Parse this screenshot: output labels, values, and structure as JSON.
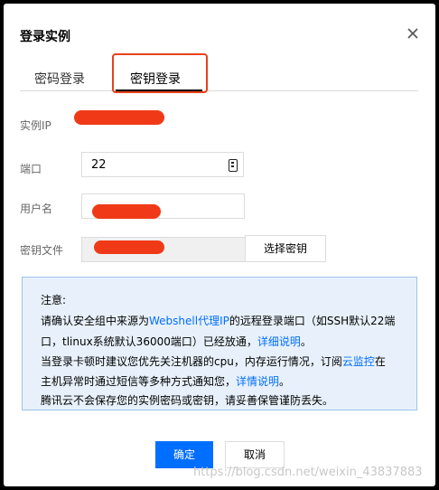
{
  "dialog": {
    "title": "登录实例",
    "close_icon": "close-icon"
  },
  "tabs": [
    {
      "label": "密码登录"
    },
    {
      "label": "密钥登录"
    }
  ],
  "form": {
    "instance_ip_label": "实例IP",
    "port_label": "端口",
    "port_value": "22",
    "username_label": "用户名",
    "key_file_label": "密钥文件",
    "select_key_button": "选择密钥"
  },
  "notice": {
    "title": "注意:",
    "line1_a": "请确认安全组中来源为",
    "line1_link": "Webshell代理IP",
    "line1_b": "的远程登录端口（如SSH默认22端",
    "line2_a": "口，tlinux系统默认36000端口）已经放通，",
    "line2_link": "详细说明",
    "line2_b": "。",
    "line3_a": "当登录卡顿时建议您优先关注机器的cpu，内存运行情况，订阅",
    "line3_link": "云监控",
    "line3_b": "在",
    "line4_a": "主机异常时通过短信等多种方式通知您，",
    "line4_link": "详情说明",
    "line4_b": "。",
    "line5": "腾讯云不会保存您的实例密码或密钥，请妥善保管谨防丢失。"
  },
  "footer": {
    "confirm": "确定",
    "cancel": "取消"
  },
  "watermark": "https://blog.csdn.net/weixin_43837883",
  "colors": {
    "primary": "#006eff",
    "highlight": "#e8421a",
    "redaction": "#f03a17",
    "notice_bg": "#e8f1fb"
  }
}
